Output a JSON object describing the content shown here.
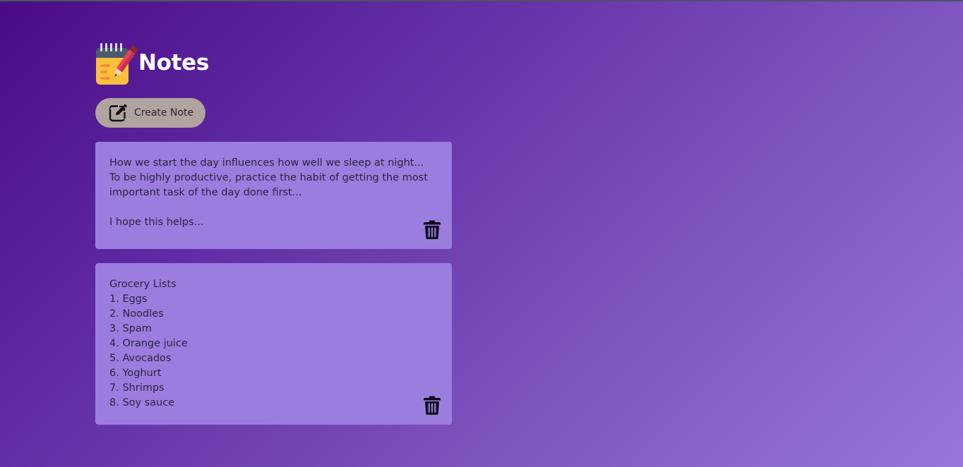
{
  "app": {
    "title": "Notes",
    "logo_icon": "notepad-pencil-icon"
  },
  "toolbar": {
    "create_label": "Create Note",
    "create_icon": "edit-note-icon"
  },
  "notes": [
    {
      "text": "How we start the day influences how well we sleep at night...\nTo be highly productive, practice the habit of getting the most important task of the day done first...\n\nI hope this helps...",
      "delete_icon": "trash-icon"
    },
    {
      "text": "Grocery Lists\n1. Eggs\n2. Noodles\n3. Spam\n4. Orange juice\n5. Avocados\n6. Yoghurt\n7. Shrimps\n8. Soy sauce",
      "delete_icon": "trash-icon"
    }
  ],
  "colors": {
    "note_bg": "#9b7ddf",
    "button_bg": "#b1a4a0",
    "gradient_start": "#4a0a86",
    "gradient_end": "#9876d9"
  }
}
